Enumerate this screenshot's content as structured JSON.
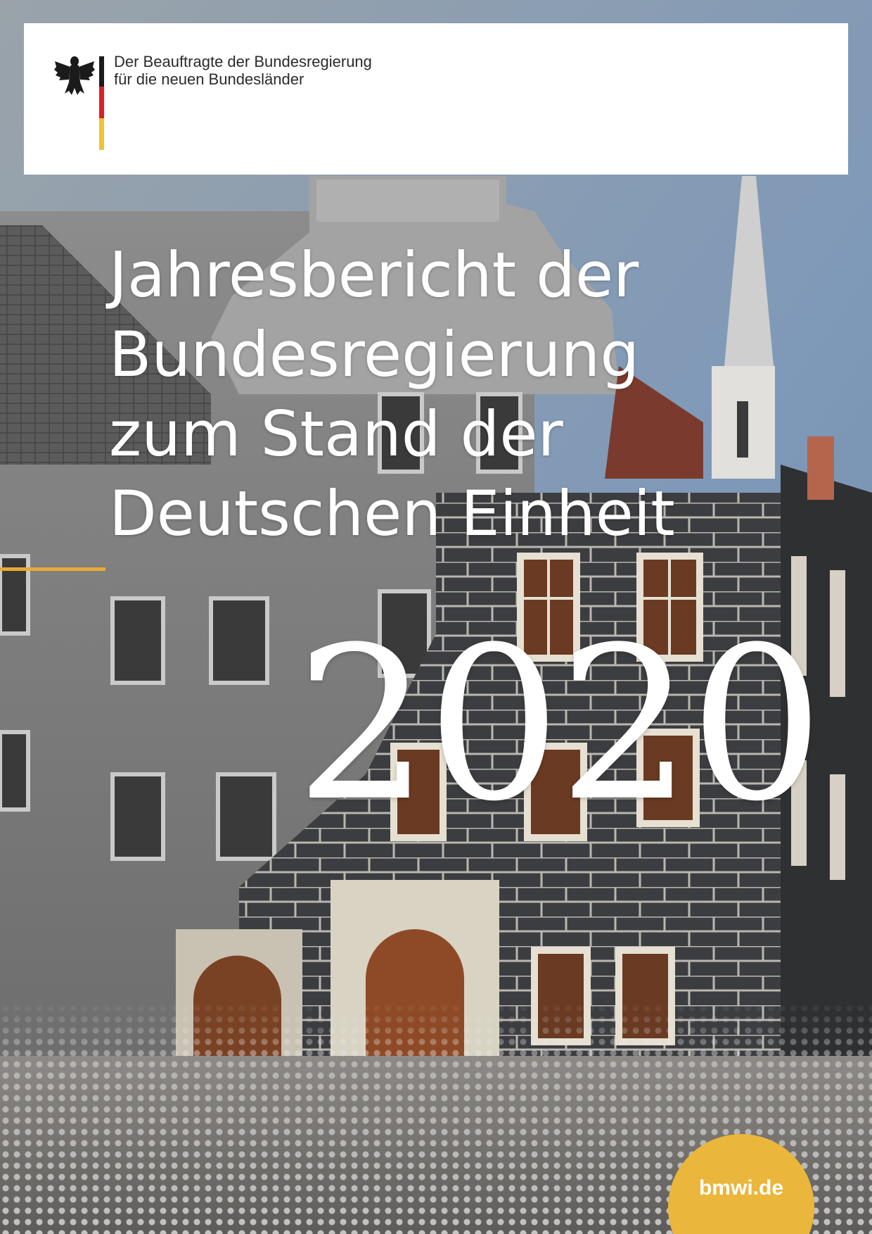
{
  "header": {
    "org_line_1": "Der Beauftragte der Bundesregierung",
    "org_line_2": "für die neuen Bundesländer",
    "emblem_icon": "federal-eagle-icon",
    "flag_colors": [
      "#1b1b1b",
      "#dd1f26",
      "#f1c232"
    ]
  },
  "title": {
    "line_1": "Jahresbericht der",
    "line_2": "Bundesregierung",
    "line_3": "zum Stand der",
    "line_4": "Deutschen Einheit"
  },
  "year": "2020",
  "badge": {
    "url": "bmwi.de",
    "color": "#eab63b"
  },
  "accent_color": "#e9a937"
}
